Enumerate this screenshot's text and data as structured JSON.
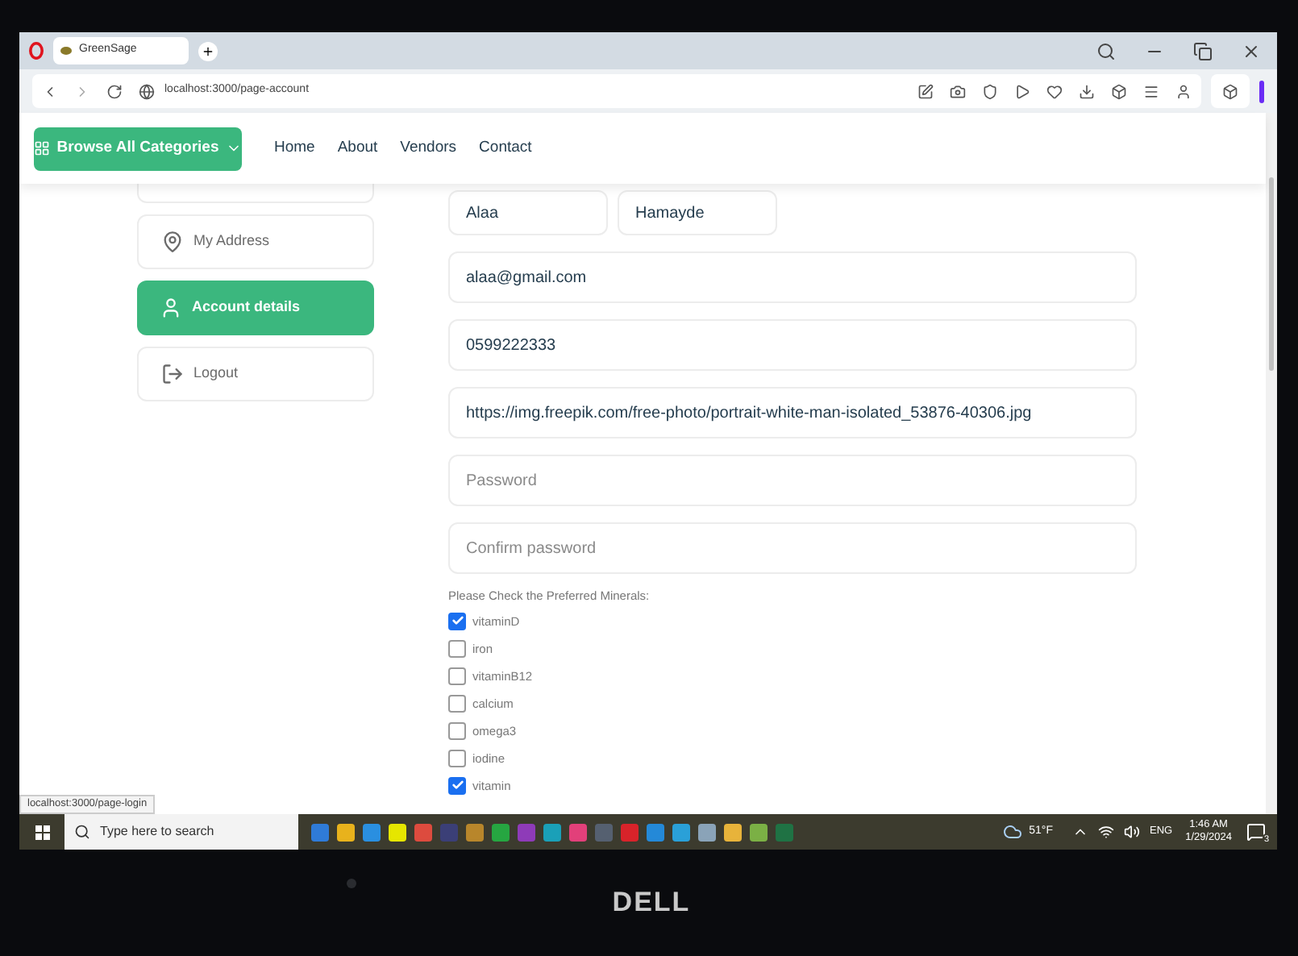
{
  "browser": {
    "tab_title": "GreenSage",
    "url": "localhost:3000/page-account",
    "status_url": "localhost:3000/page-login"
  },
  "header": {
    "browse_button": "Browse All Categories",
    "nav": [
      "Home",
      "About",
      "Vendors",
      "Contact"
    ]
  },
  "sidebar": {
    "items": [
      {
        "kind": "address",
        "label": "My Address",
        "selected": false
      },
      {
        "kind": "account",
        "label": "Account details",
        "selected": true
      },
      {
        "kind": "logout",
        "label": "Logout",
        "selected": false
      }
    ]
  },
  "form": {
    "first_name": "Alaa",
    "last_name": "Hamayde",
    "email": "alaa@gmail.com",
    "phone": "0599222333",
    "image_url": "https://img.freepik.com/free-photo/portrait-white-man-isolated_53876-40306.jpg",
    "password": {
      "placeholder": "Password"
    },
    "confirm_password": {
      "placeholder": "Confirm password"
    },
    "minerals": {
      "label": "Please Check the Preferred Minerals:",
      "options": [
        {
          "label": "vitaminD",
          "checked": true
        },
        {
          "label": "iron",
          "checked": false
        },
        {
          "label": "vitaminB12",
          "checked": false
        },
        {
          "label": "calcium",
          "checked": false
        },
        {
          "label": "omega3",
          "checked": false
        },
        {
          "label": "iodine",
          "checked": false
        },
        {
          "label": "vitamin",
          "checked": true
        }
      ]
    }
  },
  "taskbar": {
    "search_placeholder": "Type here to search",
    "weather": "51°F",
    "language": "ENG",
    "time": "1:46 AM",
    "date": "1/29/2024",
    "notifications": "3"
  },
  "device": {
    "brand": "DELL"
  }
}
